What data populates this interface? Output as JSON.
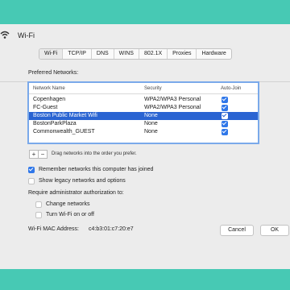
{
  "header": {
    "title": "Wi-Fi",
    "icon": "wifi-icon"
  },
  "tabs": [
    "Wi-Fi",
    "TCP/IP",
    "DNS",
    "WINS",
    "802.1X",
    "Proxies",
    "Hardware"
  ],
  "selected_tab": "Wi-Fi",
  "preferred": {
    "label": "Preferred Networks:",
    "columns": {
      "name": "Network Name",
      "security": "Security",
      "autojoin": "Auto-Join"
    },
    "rows": [
      {
        "name": "Copenhagen",
        "security": "WPA2/WPA3 Personal",
        "autojoin": true,
        "selected": false
      },
      {
        "name": "FC-Guest",
        "security": "WPA2/WPA3 Personal",
        "autojoin": true,
        "selected": false
      },
      {
        "name": "Boston Public Market Wifi",
        "security": "None",
        "autojoin": true,
        "selected": true
      },
      {
        "name": "BostonParkPlaza",
        "security": "None",
        "autojoin": true,
        "selected": false
      },
      {
        "name": "Commonwealth_GUEST",
        "security": "None",
        "autojoin": true,
        "selected": false
      }
    ],
    "add_label": "+",
    "remove_label": "−",
    "drag_hint": "Drag networks into the order you prefer."
  },
  "options": {
    "remember": {
      "label": "Remember networks this computer has joined",
      "checked": true
    },
    "legacy": {
      "label": "Show legacy networks and options",
      "checked": false
    },
    "admin_label": "Require administrator authorization to:",
    "change_networks": {
      "label": "Change networks",
      "checked": false
    },
    "turn_wifi": {
      "label": "Turn Wi-Fi on or off",
      "checked": false
    }
  },
  "mac": {
    "label": "Wi-Fi MAC Address:",
    "value": "c4:b3:01:c7:20:e7"
  },
  "buttons": {
    "cancel": "Cancel",
    "ok": "OK"
  },
  "colors": {
    "background": "#47c9b4",
    "selection": "#2a64d2",
    "checkbox": "#2f77e9"
  }
}
